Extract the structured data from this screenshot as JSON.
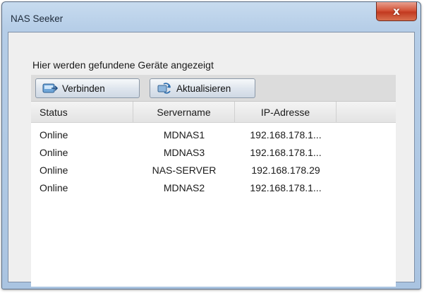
{
  "window": {
    "title": "NAS Seeker",
    "close_glyph": "x"
  },
  "main": {
    "heading": "Hier werden gefundene Geräte angezeigt"
  },
  "toolbar": {
    "connect_label": "Verbinden",
    "connect_icon": "connect-icon",
    "refresh_label": "Aktualisieren",
    "refresh_icon": "refresh-icon"
  },
  "table": {
    "columns": [
      "Status",
      "Servername",
      "IP-Adresse"
    ],
    "rows": [
      {
        "status": "Online",
        "servername": "MDNAS1",
        "ip": "192.168.178.1..."
      },
      {
        "status": "Online",
        "servername": "MDNAS3",
        "ip": "192.168.178.1..."
      },
      {
        "status": "Online",
        "servername": "NAS-SERVER",
        "ip": "192.168.178.29"
      },
      {
        "status": "Online",
        "servername": "MDNAS2",
        "ip": "192.168.178.1..."
      }
    ]
  },
  "colors": {
    "titlebar": "#b5cde7",
    "close_button": "#c8442a",
    "client_background": "#efefef"
  }
}
